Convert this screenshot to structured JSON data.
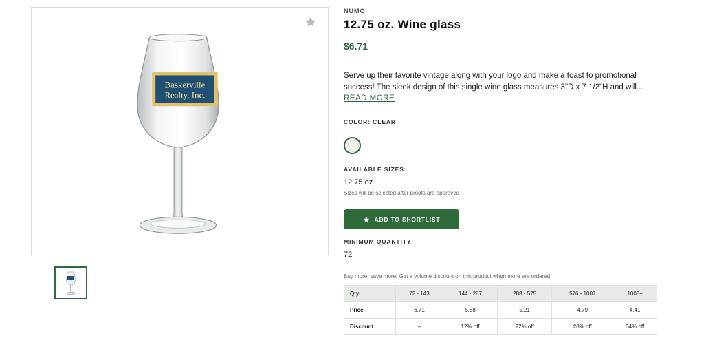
{
  "product": {
    "brand": "NUMO",
    "title": "12.75 oz. Wine glass",
    "price": "$6.71",
    "description": "Serve up their favorite vintage along with your logo and make a toast to promotional success! The sleek design of this single wine glass measures 3\"D x 7 1/2\"H and will...",
    "read_more": "READ MORE",
    "logo_line1": "Baskerville",
    "logo_line2": "Realty, Inc."
  },
  "color": {
    "label": "COLOR: CLEAR",
    "selected": "Clear"
  },
  "sizes": {
    "label": "AVAILABLE SIZES:",
    "value": "12.75 oz",
    "note": "Sizes will be selected after proofs are approved"
  },
  "actions": {
    "shortlist_label": "ADD TO SHORTLIST"
  },
  "minimum": {
    "label": "MINIMUM QUANTITY",
    "value": "72"
  },
  "pricing": {
    "promo": "Buy more, save more! Get a volume discount on this product when more are ordered.",
    "header": [
      "Qty",
      "72 - 143",
      "144 - 287",
      "288 - 575",
      "576 - 1007",
      "1008+"
    ],
    "rows": [
      [
        "Price",
        "6.71",
        "5.88",
        "5.21",
        "4.79",
        "4.41"
      ],
      [
        "Discount",
        "--",
        "12% off",
        "22% off",
        "28% off",
        "34% off"
      ]
    ]
  },
  "colors": {
    "accent": "#2e6a3a",
    "table_header_bg": "#e6ebe6"
  },
  "icons": {
    "favorite": "star-icon",
    "shortlist": "star-icon"
  }
}
